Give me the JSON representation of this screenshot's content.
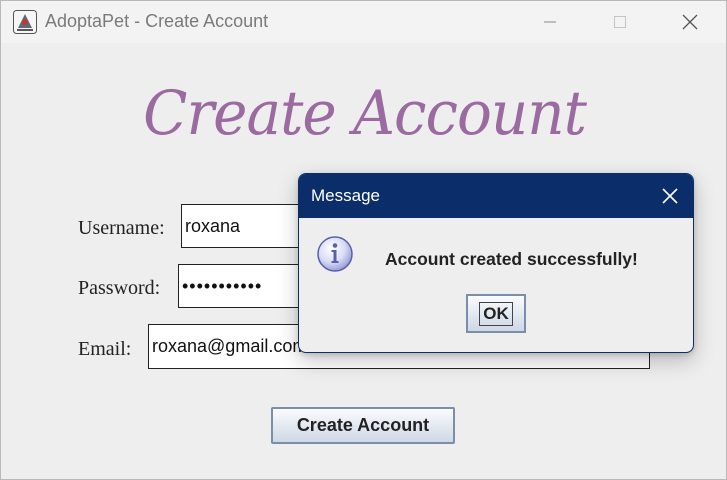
{
  "window": {
    "title": "AdoptaPet - Create Account"
  },
  "heading": "Create Account",
  "form": {
    "username_label": "Username:",
    "username_value": "roxana",
    "password_label": "Password:",
    "password_value": "•••••••••••",
    "email_label": "Email:",
    "email_value": "roxana@gmail.com"
  },
  "create_button": "Create Account",
  "dialog": {
    "title": "Message",
    "message": "Account created successfully!",
    "ok_label": "OK",
    "icon": "info-icon"
  },
  "colors": {
    "heading": "#9a6aa0",
    "dialog_titlebar": "#0b2d6a",
    "background": "#eeeeee"
  }
}
